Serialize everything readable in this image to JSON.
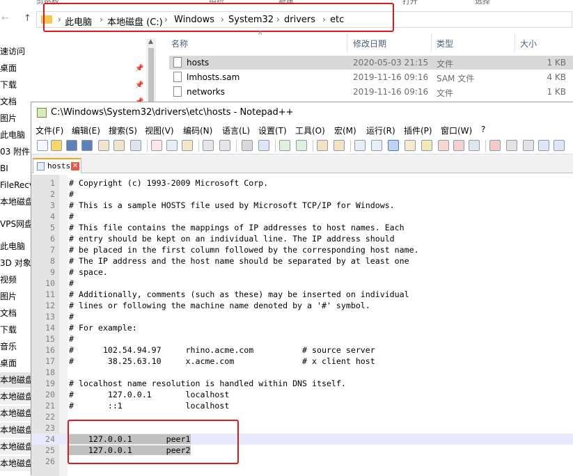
{
  "explorer": {
    "ribbon": [
      "剪贴板",
      "组织",
      "新建",
      "打开",
      "选择"
    ],
    "nav_back": "←",
    "nav_forward": "→",
    "nav_up": "↑",
    "breadcrumb": [
      "此电脑",
      "本地磁盘 (C:)",
      "Windows",
      "System32",
      "drivers",
      "etc"
    ],
    "breadcrumb_sep": "›",
    "sidebar": [
      "速访问",
      "桌面",
      "下载",
      "文档",
      "图片",
      "此电脑",
      "03 附件",
      "BI",
      "FileRecv",
      "本地磁盘",
      "VPS网盘",
      "此电脑",
      "3D 对象",
      "视频",
      "图片",
      "文档",
      "下载",
      "音乐",
      "桌面",
      "本地磁盘",
      "本地磁盘",
      "本地磁盘",
      "本地磁盘",
      "本地磁盘",
      "本地磁盘"
    ],
    "columns": {
      "name": "名称",
      "date": "修改日期",
      "type": "类型",
      "size": "大小"
    },
    "files": [
      {
        "name": "hosts",
        "date": "2020-05-03 21:15",
        "type": "文件",
        "size": "1 KB"
      },
      {
        "name": "lmhosts.sam",
        "date": "2019-11-16 09:16",
        "type": "SAM 文件",
        "size": "4 KB"
      },
      {
        "name": "networks",
        "date": "2019-11-16 09:16",
        "type": "文件",
        "size": "1 KB"
      }
    ]
  },
  "notepad": {
    "title": "C:\\Windows\\System32\\drivers\\etc\\hosts - Notepad++",
    "menu": [
      "文件(F)",
      "编辑(E)",
      "搜索(S)",
      "视图(V)",
      "编码(N)",
      "语言(L)",
      "设置(T)",
      "工具(O)",
      "宏(M)",
      "运行(R)",
      "插件(P)",
      "窗口(W)",
      "?"
    ],
    "tab_label": "hosts",
    "tab_close": "✕",
    "lines": [
      "# Copyright (c) 1993-2009 Microsoft Corp.",
      "#",
      "# This is a sample HOSTS file used by Microsoft TCP/IP for Windows.",
      "#",
      "# This file contains the mappings of IP addresses to host names. Each",
      "# entry should be kept on an individual line. The IP address should",
      "# be placed in the first column followed by the corresponding host name.",
      "# The IP address and the host name should be separated by at least one",
      "# space.",
      "#",
      "# Additionally, comments (such as these) may be inserted on individual",
      "# lines or following the machine name denoted by a '#' symbol.",
      "#",
      "# For example:",
      "#",
      "#      102.54.94.97     rhino.acme.com          # source server",
      "#       38.25.63.10     x.acme.com              # x client host",
      "",
      "# localhost name resolution is handled within DNS itself.",
      "#\t127.0.0.1       localhost",
      "#\t::1             localhost",
      "",
      "",
      "    127.0.0.1       peer1",
      "    127.0.0.1       peer2",
      ""
    ]
  }
}
